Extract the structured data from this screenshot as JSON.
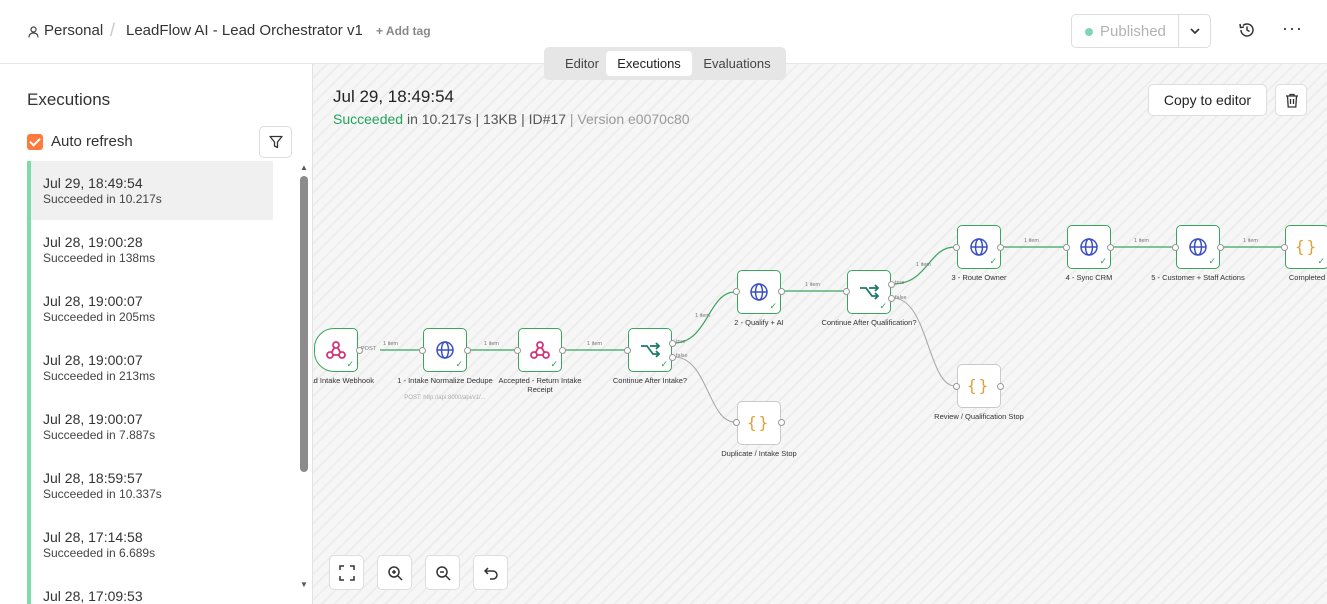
{
  "header": {
    "owner": "Personal",
    "workflow_name": "LeadFlow AI - Lead Orchestrator v1",
    "add_tag": "+ Add tag",
    "status_label": "Published"
  },
  "tabs": [
    {
      "label": "Editor",
      "active": false
    },
    {
      "label": "Executions",
      "active": true
    },
    {
      "label": "Evaluations",
      "active": false
    }
  ],
  "sidebar": {
    "title": "Executions",
    "auto_refresh_label": "Auto refresh",
    "auto_refresh_checked": true,
    "executions": [
      {
        "date": "Jul 29, 18:49:54",
        "status": "Succeeded in 10.217s",
        "selected": true
      },
      {
        "date": "Jul 28, 19:00:28",
        "status": "Succeeded in 138ms",
        "selected": false
      },
      {
        "date": "Jul 28, 19:00:07",
        "status": "Succeeded in 205ms",
        "selected": false
      },
      {
        "date": "Jul 28, 19:00:07",
        "status": "Succeeded in 213ms",
        "selected": false
      },
      {
        "date": "Jul 28, 19:00:07",
        "status": "Succeeded in 7.887s",
        "selected": false
      },
      {
        "date": "Jul 28, 18:59:57",
        "status": "Succeeded in 10.337s",
        "selected": false
      },
      {
        "date": "Jul 28, 17:14:58",
        "status": "Succeeded in 6.689s",
        "selected": false
      },
      {
        "date": "Jul 28, 17:09:53",
        "status": "",
        "selected": false
      }
    ]
  },
  "execution": {
    "date": "Jul 29, 18:49:54",
    "status_word": "Succeeded",
    "duration": " in 10.217s",
    "size": " | 13KB | ",
    "id": "ID#17",
    "version": " | Version e0070c80"
  },
  "canvas": {
    "copy_button": "Copy to editor",
    "accent_success": "#3aa55d",
    "nodes": [
      {
        "label": "Lead Intake Webhook",
        "icon": "webhook-icon"
      },
      {
        "label": "1 - Intake Normalize Dedupe",
        "sub": "POST: http://api:8000/api/v1/...",
        "icon": "globe-icon"
      },
      {
        "label": "Accepted - Return Intake Receipt",
        "icon": "webhook-icon"
      },
      {
        "label": "Continue After Intake?",
        "icon": "branch-icon"
      },
      {
        "label": "Duplicate / Intake Stop",
        "icon": "code-icon"
      },
      {
        "label": "2 - Qualify + AI",
        "icon": "globe-icon"
      },
      {
        "label": "Continue After Qualification?",
        "icon": "branch-icon"
      },
      {
        "label": "Review / Qualification Stop",
        "icon": "code-icon"
      },
      {
        "label": "3 - Route Owner",
        "icon": "globe-icon"
      },
      {
        "label": "4 - Sync CRM",
        "icon": "globe-icon"
      },
      {
        "label": "5 - Customer + Staff Actions",
        "icon": "globe-icon"
      },
      {
        "label": "Completed",
        "icon": "code-icon"
      }
    ],
    "edge_item_label": "1 item",
    "post_label": "POST",
    "true_label": "true",
    "false_label": "false"
  }
}
